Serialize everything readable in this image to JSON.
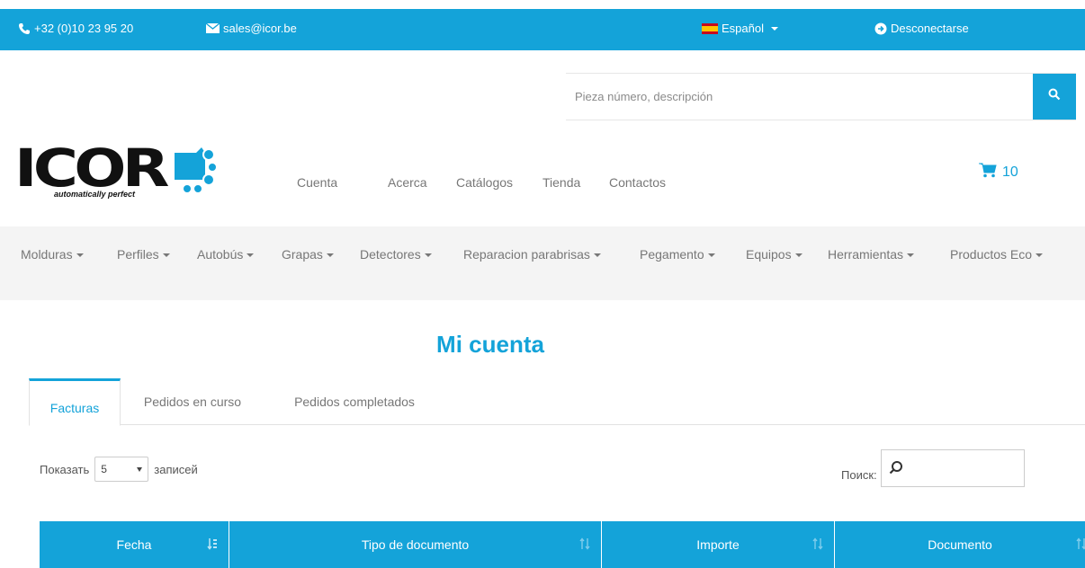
{
  "topbar": {
    "phone": "+32 (0)10 23 95 20",
    "email": "sales@icor.be",
    "language": "Español",
    "logout": "Desconectarse"
  },
  "search": {
    "placeholder": "Pieza número, descripción"
  },
  "logo": {
    "text": "ICOR",
    "tagline": "automatically perfect"
  },
  "mainnav": [
    "Cuenta",
    "Acerca",
    "Catálogos",
    "Tienda",
    "Contactos"
  ],
  "cart": {
    "count": "10"
  },
  "categories": [
    "Molduras",
    "Perfiles",
    "Autobús",
    "Grapas",
    "Detectores",
    "Reparacion parabrisas",
    "Pegamento",
    "Equipos",
    "Herramientas",
    "Productos Eco"
  ],
  "page": {
    "title": "Mi cuenta"
  },
  "tabs": [
    "Facturas",
    "Pedidos en curso",
    "Pedidos completados"
  ],
  "table_controls": {
    "show_label": "Показать",
    "show_value": "5",
    "entries_label": "записей",
    "search_label": "Поиск:"
  },
  "table": {
    "columns": [
      "Fecha",
      "Tipo de documento",
      "Importe",
      "Documento"
    ]
  },
  "colors": {
    "accent": "#14a3d9",
    "category_bg": "#f4f4f4"
  }
}
